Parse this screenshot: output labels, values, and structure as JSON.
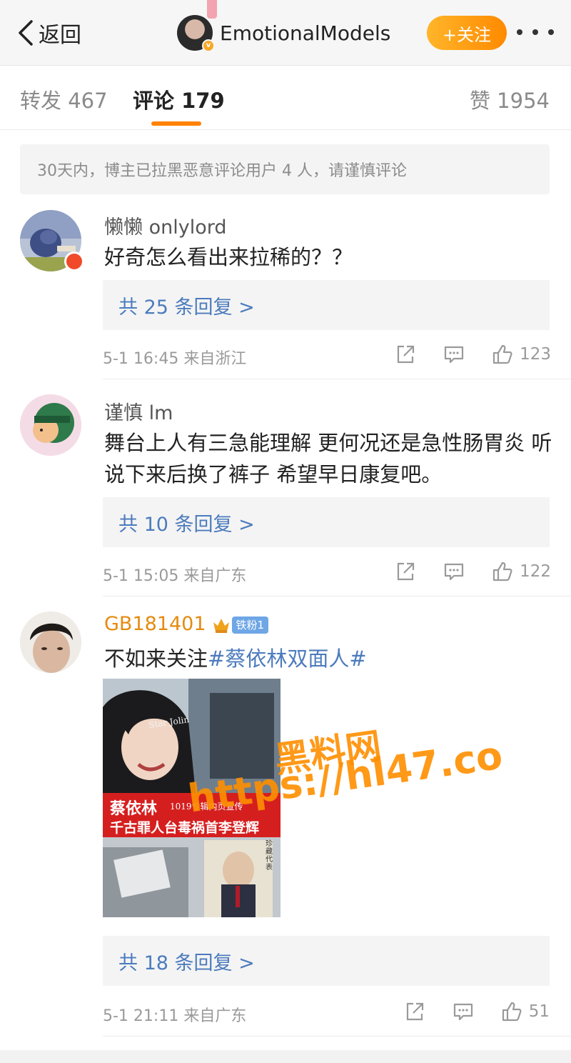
{
  "header": {
    "back_label": "返回",
    "account_name": "EmotionalModels",
    "follow_label": "+关注",
    "verified_badge": "v"
  },
  "tabs": [
    {
      "label": "转发 467",
      "active": false
    },
    {
      "label": "评论 179",
      "active": true
    },
    {
      "label": "赞 1954",
      "active": false
    }
  ],
  "notice": "30天内，博主已拉黑恶意评论用户 4 人，请谨慎评论",
  "comments": [
    {
      "user": "懒懒 onlylord",
      "text": "好奇怎么看出来拉稀的？？",
      "replies": "共 25 条回复 >",
      "meta": "5-1 16:45  来自浙江",
      "likes": "123"
    },
    {
      "user": "谨慎 lm",
      "text": "舞台上人有三急能理解 更何况还是急性肠胃炎 听说下来后换了裤子  希望早日康复吧。",
      "replies": "共 10 条回复 >",
      "meta": "5-1 15:05  来自广东",
      "likes": "122"
    },
    {
      "user": "GB181401",
      "fan_badge": "铁粉1",
      "text_prefix": "不如来关注",
      "topic": "#蔡依林双面人#",
      "image": {
        "overlay_text": "Star Jolin",
        "banner_line1": "蔡依林",
        "banner_line1_small": "1019专辑内页宣传",
        "banner_line2": "千古罪人台毒祸首李登辉",
        "caption_right": "珍藏代表"
      },
      "replies": "共 18 条回复 >",
      "meta": "5-1 21:11  来自广东",
      "likes": "51"
    }
  ],
  "watermark": {
    "line1": "黑料网",
    "line2": "https://hl47.co"
  },
  "colors": {
    "accent": "#ff8200",
    "link": "#4c7bbd",
    "gold_name": "#e58b10"
  }
}
